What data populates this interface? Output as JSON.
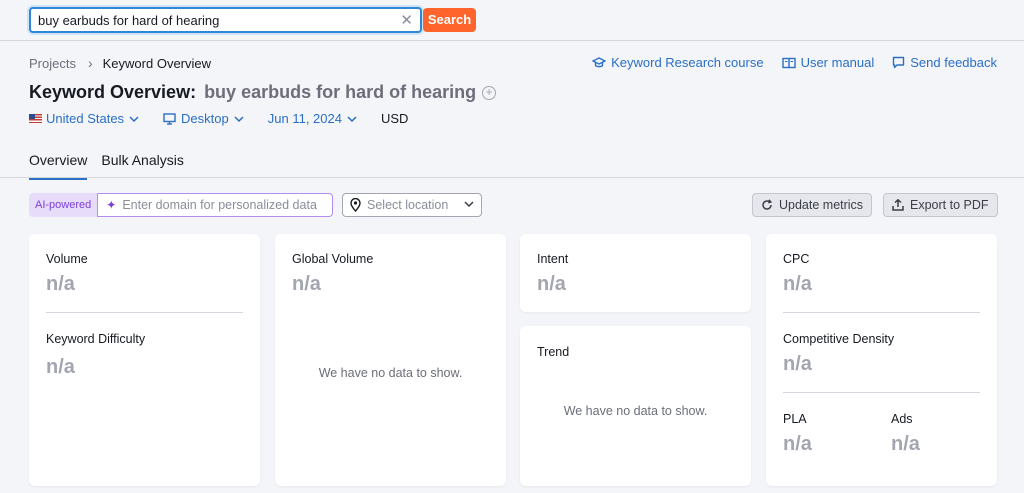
{
  "search": {
    "value": "buy earbuds for hard of hearing",
    "button": "Search"
  },
  "breadcrumb": {
    "items": [
      "Projects",
      "Keyword Overview"
    ]
  },
  "links": {
    "course": "Keyword Research course",
    "manual": "User manual",
    "feedback": "Send feedback"
  },
  "header": {
    "title": "Keyword Overview:",
    "keyword": "buy earbuds for hard of hearing"
  },
  "filters": {
    "country": "United States",
    "device": "Desktop",
    "date": "Jun 11, 2024",
    "currency": "USD"
  },
  "tabs": [
    {
      "label": "Overview"
    },
    {
      "label": "Bulk Analysis"
    }
  ],
  "toolbar": {
    "ai_badge": "AI-powered",
    "domain_placeholder": "Enter domain for personalized data",
    "location": "Select location",
    "update": "Update metrics",
    "export": "Export to PDF"
  },
  "cards": {
    "volume": {
      "label": "Volume",
      "value": "n/a"
    },
    "kd": {
      "label": "Keyword Difficulty",
      "value": "n/a"
    },
    "global": {
      "label": "Global Volume",
      "value": "n/a",
      "empty": "We have no data to show."
    },
    "intent": {
      "label": "Intent",
      "value": "n/a"
    },
    "trend": {
      "label": "Trend",
      "empty": "We have no data to show."
    },
    "cpc": {
      "label": "CPC",
      "value": "n/a"
    },
    "density": {
      "label": "Competitive Density",
      "value": "n/a"
    },
    "pla": {
      "label": "PLA",
      "value": "n/a"
    },
    "ads": {
      "label": "Ads",
      "value": "n/a"
    }
  },
  "colors": {
    "accent": "#2a6fc4",
    "search_button": "#ff642d",
    "ai": "#7b3fd6"
  }
}
